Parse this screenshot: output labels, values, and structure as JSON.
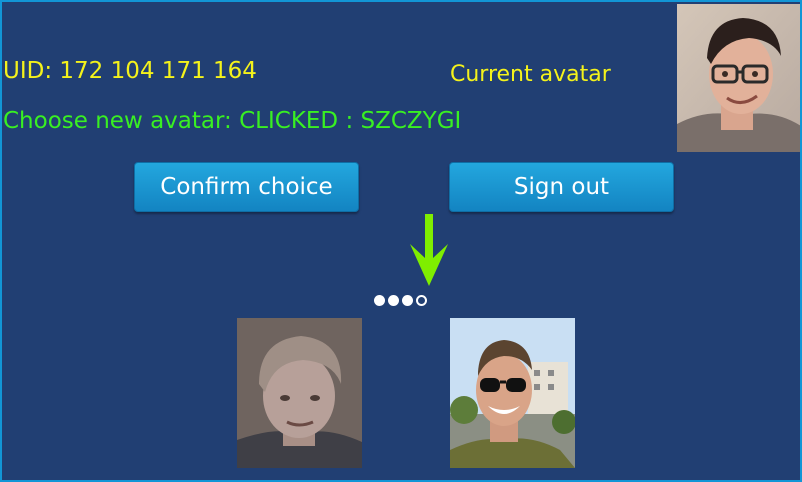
{
  "uid": "UID: 172 104 171 164",
  "choose_text": "Choose new avatar: CLICKED : SZCZYGI",
  "current_avatar_label": "Current avatar",
  "buttons": {
    "confirm": "Confirm choice",
    "sign_out": "Sign out"
  },
  "carousel": {
    "total_pages": 4,
    "active_page": 4
  },
  "colors": {
    "background": "#213f73",
    "uid_text": "#f4f21b",
    "choose_text": "#39f022",
    "button": "#1a95d0",
    "arrow": "#7fee00"
  },
  "icons": {
    "arrow": "down-arrow-icon"
  }
}
